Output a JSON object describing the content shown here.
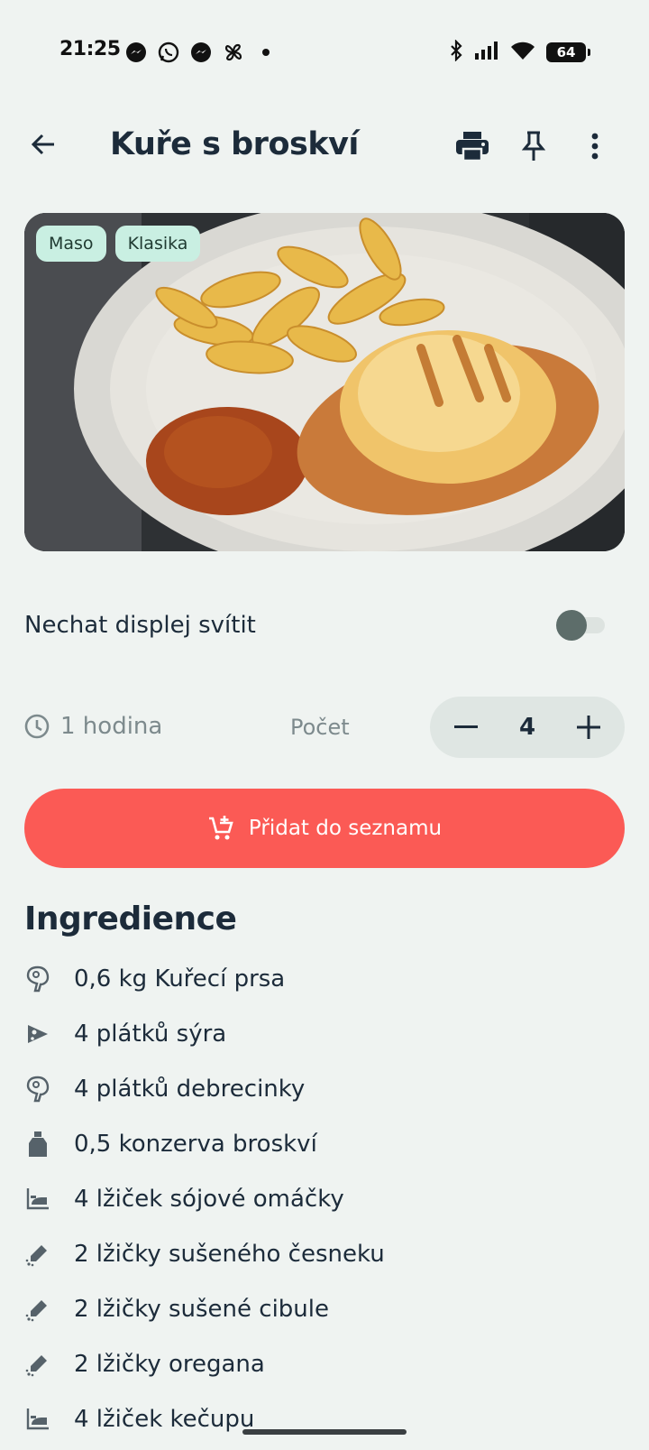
{
  "status_bar": {
    "time": "21:25",
    "battery": "64"
  },
  "header": {
    "title": "Kuře s broskví"
  },
  "hero": {
    "tags": [
      "Maso",
      "Klasika"
    ]
  },
  "keep_screen": {
    "label": "Nechat displej svítit",
    "enabled": false
  },
  "meta": {
    "duration": "1 hodina",
    "count_label": "Počet",
    "count": "4"
  },
  "add_button": {
    "label": "Přidat do seznamu"
  },
  "ingredients": {
    "heading": "Ingredience",
    "items": [
      {
        "text": "0,6 kg Kuřecí prsa",
        "icon": "meat-icon"
      },
      {
        "text": "4 plátků sýra",
        "icon": "cheese-icon"
      },
      {
        "text": "4 plátků debrecinky",
        "icon": "meat-icon"
      },
      {
        "text": "0,5 konzerva broskví",
        "icon": "jar-icon"
      },
      {
        "text": "4 lžiček sójové omáčky",
        "icon": "sauce-icon"
      },
      {
        "text": "2 lžičky sušeného česneku",
        "icon": "spice-icon"
      },
      {
        "text": "2 lžičky sušené cibule",
        "icon": "spice-icon"
      },
      {
        "text": "2 lžičky oregana",
        "icon": "spice-icon"
      },
      {
        "text": "4 lžiček kečupu",
        "icon": "sauce-icon"
      }
    ]
  }
}
